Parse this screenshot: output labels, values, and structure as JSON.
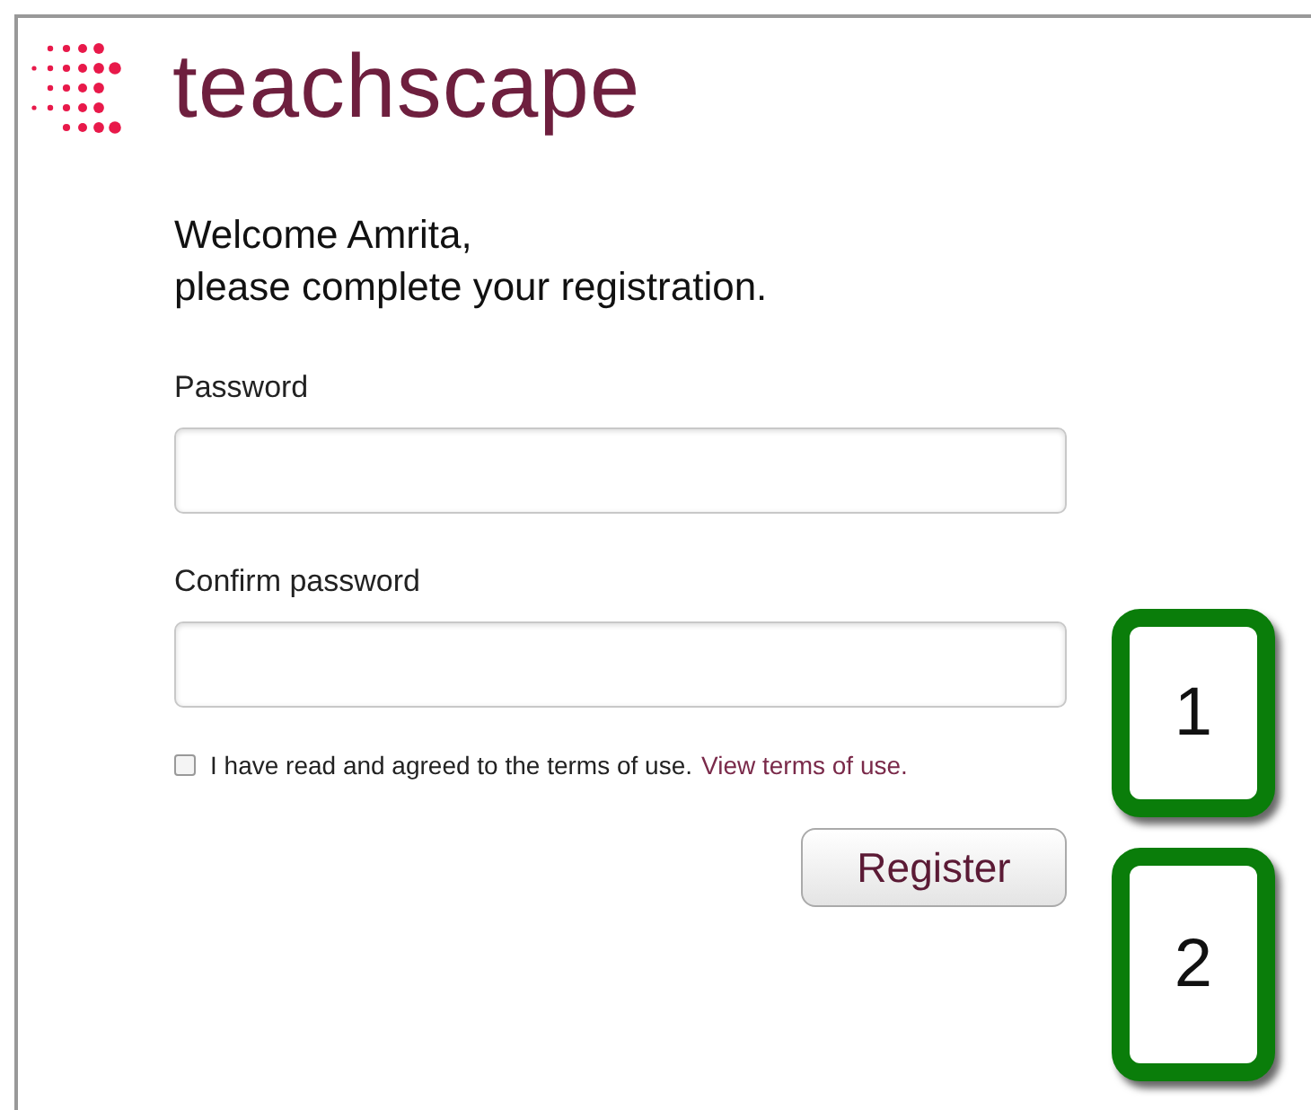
{
  "logo": {
    "name": "teachscape"
  },
  "heading": [
    "Welcome Amrita,",
    "please complete your registration."
  ],
  "fields": [
    {
      "label": "Password"
    },
    {
      "label": "Confirm password"
    }
  ],
  "terms": {
    "checked": false,
    "text": "I have read and agreed to the terms of use.",
    "link": "View terms of use."
  },
  "button": "Register",
  "callouts": [
    "1",
    "2"
  ]
}
